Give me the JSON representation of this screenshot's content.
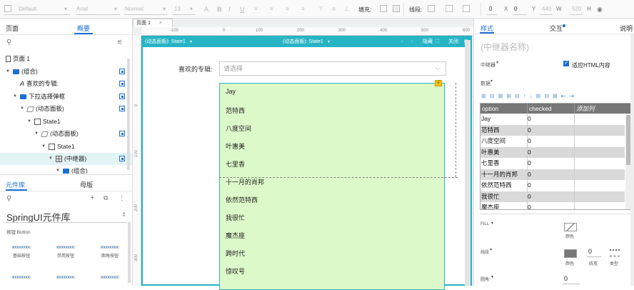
{
  "toolbar": {
    "style_dropdown": "Default",
    "font_dropdown": "Arial",
    "weight_dropdown": "Normal",
    "font_size": "13",
    "fill_label": "填充:",
    "border_label": "线段:",
    "x_value": "0",
    "x_label": "X",
    "y_value": "0",
    "y_label": "Y",
    "w_value": "440",
    "w_label": "W",
    "h_value": "520",
    "h_label": "H"
  },
  "left": {
    "tabs": [
      "页面",
      "概要"
    ],
    "active_tab": "概要",
    "tree": [
      {
        "label": "页面 1",
        "icon": "page-icon",
        "level": 0
      },
      {
        "label": "(组合)",
        "icon": "folder-icon",
        "level": 0
      },
      {
        "label": "喜欢的专辑:",
        "icon": "text-icon",
        "level": 1
      },
      {
        "label": "下拉选择弹框",
        "icon": "folder-icon",
        "level": 1
      },
      {
        "label": "(动态面板)",
        "icon": "layers-icon",
        "level": 2
      },
      {
        "label": "State1",
        "icon": "state-icon",
        "level": 3
      },
      {
        "label": "(动态面板)",
        "icon": "layers-icon",
        "level": 4
      },
      {
        "label": "State1",
        "icon": "state-icon",
        "level": 5
      },
      {
        "label": "(中继器)",
        "icon": "repeater-icon",
        "level": 6
      },
      {
        "label": "(组合)",
        "icon": "folder-icon",
        "level": 7
      }
    ],
    "lib_tabs": [
      "元件库",
      "母版"
    ],
    "active_lib_tab": "元件库",
    "library_name": "SpringUI元件库",
    "section_label": "按钮 Button",
    "widgets": [
      "基础按钮",
      "禁用按钮",
      "图角按钮"
    ]
  },
  "canvas": {
    "page_tab": "页面 1",
    "ruler_ticks_h": [
      "-100",
      "0",
      "100",
      "200",
      "300",
      "400",
      "500",
      "600"
    ],
    "ruler_ticks_v": [
      "0",
      "100",
      "200",
      "300"
    ],
    "editor_left_title": "(动态面板): State1",
    "editor_center_title": "(动态面板): State1",
    "hide_label": "隐藏",
    "close_label": "关闭",
    "field_label": "喜欢的专辑:",
    "field_placeholder": "请选择",
    "options": [
      "Jay",
      "范特西",
      "八度空间",
      "叶惠美",
      "七里香",
      "十一月的肖邦",
      "依然范特西",
      "我很忙",
      "魔杰座",
      "跨时代",
      "惊叹号"
    ]
  },
  "right": {
    "tabs": [
      "样式",
      "交互",
      "说明"
    ],
    "active_tab": "样式",
    "name_placeholder": "(中继器名称)",
    "repeater_label": "中继器",
    "fit_html_label": "适应HTML内容",
    "data_label": "数据",
    "columns": [
      "option",
      "checked",
      "添加列"
    ],
    "rows": [
      [
        "Jay",
        "0"
      ],
      [
        "范特西",
        "0"
      ],
      [
        "八度空间",
        "0"
      ],
      [
        "叶惠美",
        "0"
      ],
      [
        "七里香",
        "0"
      ],
      [
        "十一月的肖邦",
        "0"
      ],
      [
        "依然范特西",
        "0"
      ],
      [
        "我很忙",
        "0"
      ],
      [
        "魔杰座",
        "0"
      ]
    ],
    "fill_label": "FILL",
    "color_label": "颜色",
    "line_label": "线段",
    "line_color_label": "颜色",
    "line_width_value": "0",
    "line_width_label": "线宽",
    "line_type_label": "类型",
    "corner_label": "圆角",
    "corner_value": "0"
  },
  "colors": {
    "accent": "#1d6fd6",
    "panel_teal": "#27b4c5",
    "dropdown_green": "#dcf9c9"
  }
}
